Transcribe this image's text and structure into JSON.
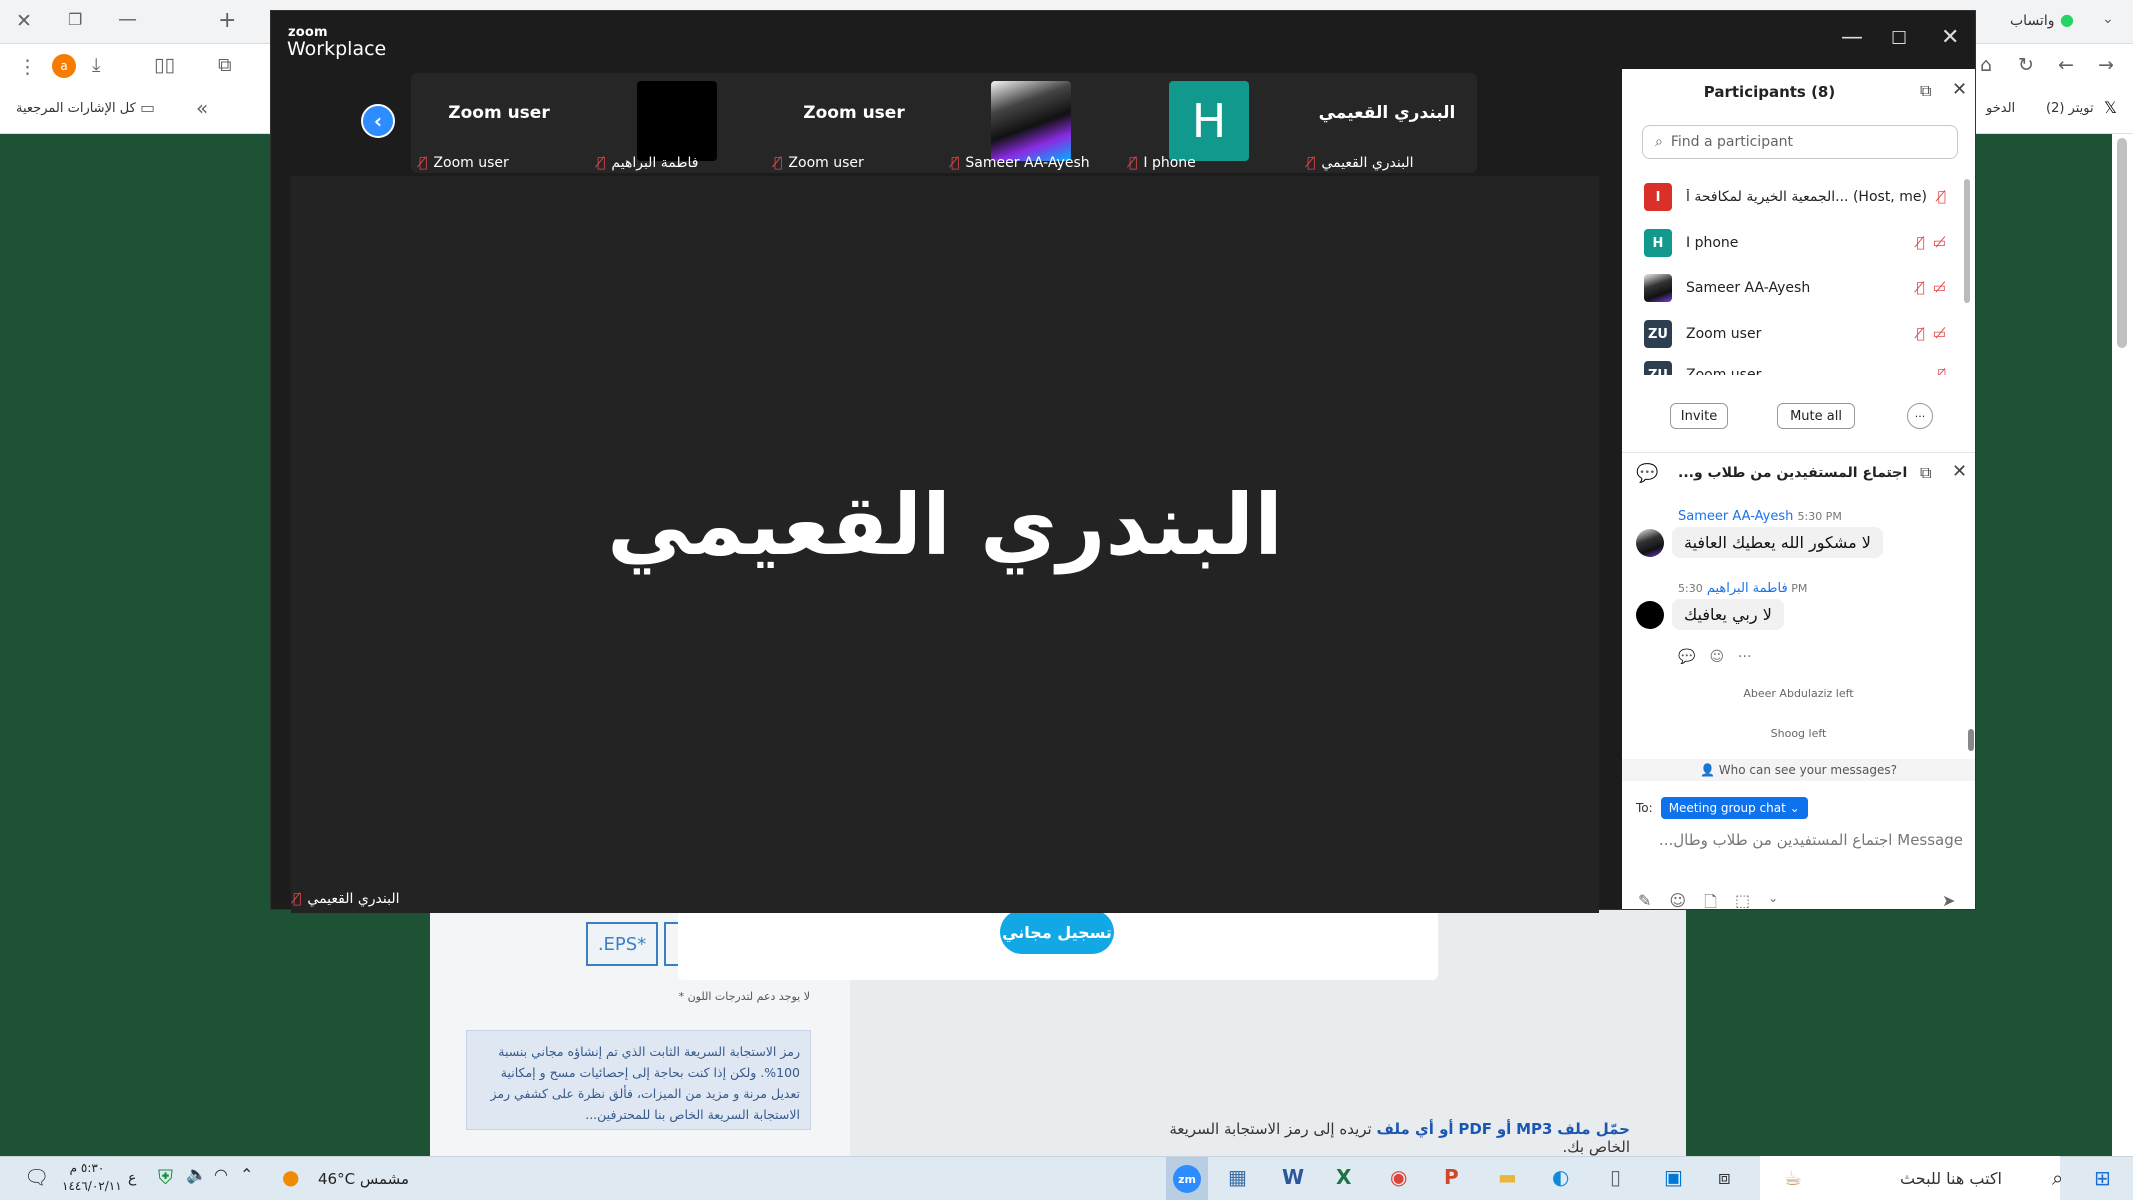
{
  "browser": {
    "right_tab_label": "واتساب",
    "right_tab2": "(2) تويتر",
    "right_tab3": "الدخو",
    "bookmarks_label": "كل الإشارات المرجعية",
    "chevrons": "«"
  },
  "webpage": {
    "eps_label": ".EPS*",
    "color_note": "* لا يوجد دعم لتدرجات اللون",
    "info_box": "رمز الاستجابة السريعة الثابت الذي تم إنشاؤه مجاني بنسبة 100%. ولكن إذا كنت بحاجة إلى إحصائيات مسح و إمكانية تعديل مرنة و مزيد من الميزات، فألق نظرة على كشفي رمز الاستجابة السريعة الخاص بنا للمحترفين...",
    "convert_text_pre": "حمّل ملف",
    "convert_mp3": "MP3",
    "convert_or": "أو",
    "convert_pdf": "PDF",
    "convert_or2": "أو أي ملف",
    "convert_rest": "تريده إلى رمز الاستجابة السريعة الخاص بك.",
    "signup_button": "تسجيل مجاني"
  },
  "zoom": {
    "logo_small": "zoom",
    "logo_big": "Workplace",
    "thumbnails": [
      {
        "name": "Zoom user",
        "label": "Zoom user",
        "kind": "name"
      },
      {
        "name": "",
        "label": "فاطمة البراهيم",
        "kind": "black"
      },
      {
        "name": "Zoom user",
        "label": "Zoom user",
        "kind": "name"
      },
      {
        "name": "",
        "label": "Sameer AA-Ayesh",
        "kind": "photo"
      },
      {
        "name": "H",
        "label": "I phone",
        "kind": "letter"
      },
      {
        "name": "البندري القعيمي",
        "label": "البندري القعيمي",
        "kind": "name"
      }
    ],
    "main_speaker": "البندري القعيمي",
    "main_label": "البندري القعيمي"
  },
  "participants": {
    "title": "Participants (8)",
    "search_placeholder": "Find a participant",
    "list": [
      {
        "initial": "I",
        "color": "#d9302a",
        "name": "الجمعية الخيرية لمكافحة أ...",
        "suffix": "(Host, me)"
      },
      {
        "initial": "H",
        "color": "#11998e",
        "name": "I phone",
        "suffix": ""
      },
      {
        "initial": "",
        "color": "#333333",
        "name": "Sameer AA-Ayesh",
        "suffix": ""
      },
      {
        "initial": "ZU",
        "color": "#2d3e50",
        "name": "Zoom user",
        "suffix": ""
      },
      {
        "initial": "ZU",
        "color": "#2d3e50",
        "name": "Zoom user",
        "suffix": ""
      }
    ],
    "invite_label": "Invite",
    "mute_all_label": "Mute all",
    "more_label": "···"
  },
  "chat": {
    "title": "اجتماع المستفيدين من طلاب و...",
    "messages": [
      {
        "sender": "Sameer AA-Ayesh",
        "time": "5:30 PM",
        "text": "لا مشكور الله يعطيك العافية"
      },
      {
        "sender": "فاطمة البراهيم",
        "time": "5:30 PM",
        "text": "لا ربي يعافيك"
      }
    ],
    "system1": "Abeer Abdulaziz left",
    "system2": "Shoog left",
    "who_can_see": "Who can see your messages?",
    "to_label": "To:",
    "to_chip": "Meeting group chat ⌄",
    "message_placeholder": "Message اجتماع المستفيدين من طلاب وطال..."
  },
  "taskbar": {
    "weather": "46°C  مشمس",
    "clock_time": "٥:٣٠ م",
    "clock_date": "١٤٤٦/٠٢/١١",
    "lang": "ع",
    "search": "اكتب هنا للبحث"
  },
  "colors": {
    "zoom_blue": "#2d8cff",
    "mute_red": "#e0474c",
    "page_green": "#1d5234"
  }
}
